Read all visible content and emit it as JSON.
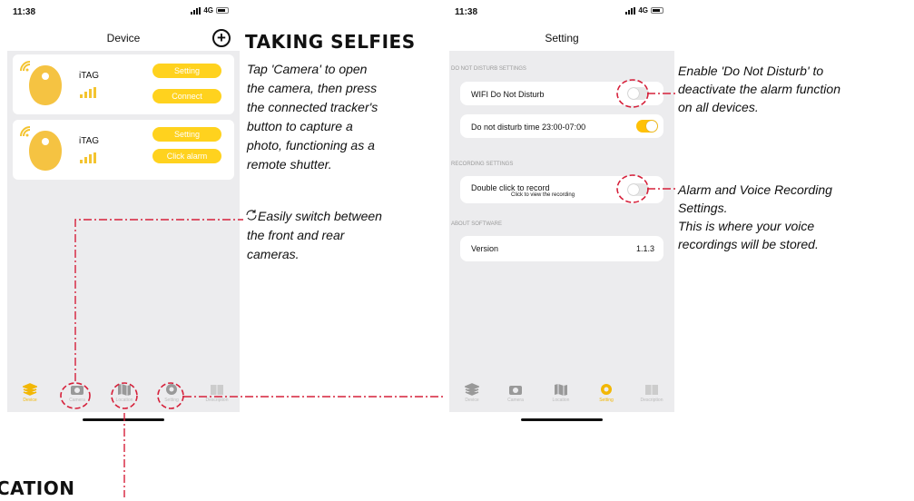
{
  "phone_left": {
    "status": {
      "time": "11:38",
      "network": "4G"
    },
    "nav_title": "Device",
    "devices": [
      {
        "name": "iTAG",
        "primary_label": "Setting",
        "secondary_label": "Connect"
      },
      {
        "name": "iTAG",
        "primary_label": "Setting",
        "secondary_label": "Click alarm"
      }
    ],
    "tabs": [
      {
        "label": "Device",
        "icon": "layers-icon",
        "active": true
      },
      {
        "label": "Camera",
        "icon": "camera-icon",
        "active": false
      },
      {
        "label": "Location",
        "icon": "map-icon",
        "active": false
      },
      {
        "label": "Setting",
        "icon": "gear-icon",
        "active": false
      },
      {
        "label": "Description",
        "icon": "book-icon",
        "active": false
      }
    ]
  },
  "phone_right": {
    "status": {
      "time": "11:38",
      "network": "4G"
    },
    "nav_title": "Setting",
    "section_dnd": "DO NOT DISTURB SETTINGS",
    "wifi_dnd": "WIFI Do Not Disturb",
    "dnd_time": "Do not disturb time 23:00-07:00",
    "section_recording": "RECORDING SETTINGS",
    "double_click": "Double click to record",
    "view_recording": "Click to view the recording",
    "section_about": "ABOUT SOFTWARE",
    "version_label": "Version",
    "version_value": "1.1.3",
    "tabs": [
      {
        "label": "Device",
        "icon": "layers-icon",
        "active": false
      },
      {
        "label": "Camera",
        "icon": "camera-icon",
        "active": false
      },
      {
        "label": "Location",
        "icon": "map-icon",
        "active": false
      },
      {
        "label": "Setting",
        "icon": "gear-icon",
        "active": true
      },
      {
        "label": "Description",
        "icon": "book-icon",
        "active": false
      }
    ]
  },
  "selfie": {
    "heading": "TAKING SELFIES",
    "lines": [
      "Tap 'Camera' to open",
      "the camera, then press",
      "the connected tracker's",
      "button to capture a",
      "photo, functioning as a",
      "remote shutter."
    ],
    "switch_lines": [
      "Easily switch between",
      "the front and rear",
      "cameras."
    ]
  },
  "annot_dnd": [
    "Enable 'Do Not Disturb' to",
    "deactivate the alarm function",
    "on all devices."
  ],
  "annot_record": [
    "Alarm and Voice Recording",
    "Settings.",
    "This is where your voice",
    "recordings will be stored."
  ],
  "location_heading": "CATION",
  "colors": {
    "accent": "#ffd21e",
    "callout": "#d6203a",
    "background": "#ececee"
  }
}
